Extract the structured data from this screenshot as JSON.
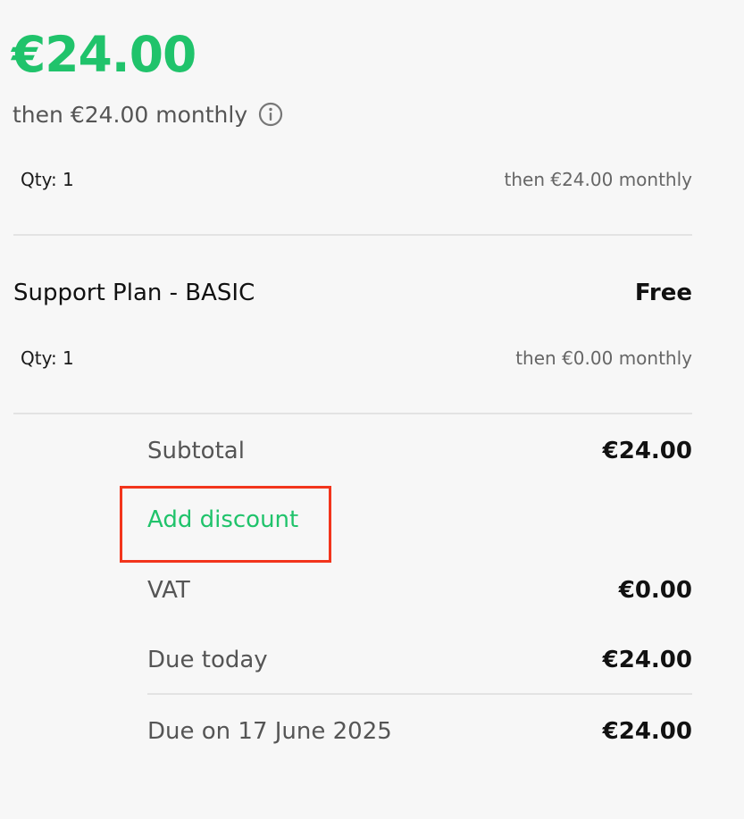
{
  "header": {
    "price": "€24.00",
    "subtitle": "then €24.00 monthly",
    "info_icon": "info-circle-icon"
  },
  "items": [
    {
      "name": "",
      "price": "",
      "qty_label": "Qty: 1",
      "recurring": "then €24.00 monthly"
    },
    {
      "name": "Support Plan - BASIC",
      "price": "Free",
      "qty_label": "Qty: 1",
      "recurring": "then €0.00 monthly"
    }
  ],
  "summary": {
    "subtotal_label": "Subtotal",
    "subtotal_value": "€24.00",
    "discount_link": "Add discount",
    "vat_label": "VAT",
    "vat_value": "€0.00",
    "due_today_label": "Due today",
    "due_today_value": "€24.00",
    "due_later_label": "Due on 17 June 2025",
    "due_later_value": "€24.00"
  },
  "colors": {
    "accent": "#20c36b",
    "highlight_box": "#f2351c",
    "background": "#f7f7f7"
  }
}
